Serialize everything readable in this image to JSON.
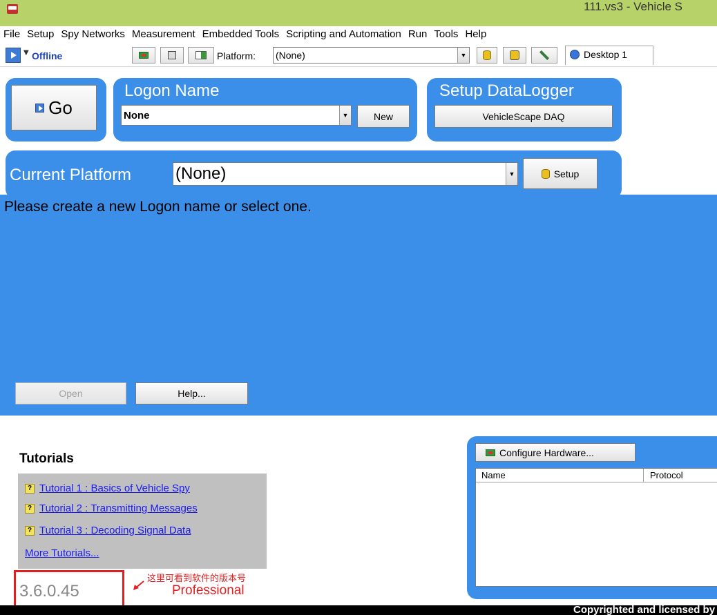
{
  "window": {
    "title": "111.vs3 - Vehicle S"
  },
  "menu": [
    {
      "label": "File"
    },
    {
      "label": "Setup"
    },
    {
      "label": "Spy Networks"
    },
    {
      "label": "Measurement"
    },
    {
      "label": "Embedded Tools"
    },
    {
      "label": "Scripting and Automation"
    },
    {
      "label": "Run"
    },
    {
      "label": "Tools"
    },
    {
      "label": "Help"
    }
  ],
  "toolbar": {
    "status": "Offline",
    "platform_label": "Platform:",
    "platform_value": "(None)",
    "desktop_tab": "Desktop 1"
  },
  "go_panel": {
    "go_label": "Go"
  },
  "logon": {
    "title": "Logon Name",
    "selected": "None",
    "new_label": "New"
  },
  "datalogger": {
    "title": "Setup DataLogger",
    "button_label": "VehicleScape DAQ"
  },
  "platform_panel": {
    "title": "Current Platform",
    "selected": "(None)",
    "setup_label": "Setup"
  },
  "content": {
    "message": "Please create a new Logon name or select one.",
    "open_label": "Open",
    "help_label": "Help..."
  },
  "tutorials": {
    "heading": "Tutorials",
    "items": [
      {
        "label": "Tutorial 1 : Basics of Vehicle Spy"
      },
      {
        "label": "Tutorial 2 : Transmitting Messages"
      },
      {
        "label": "Tutorial 3 : Decoding Signal Data"
      }
    ],
    "more_label": "More Tutorials..."
  },
  "version": {
    "number": "3.6.0.45",
    "annotation": "这里可看到软件的版本号",
    "edition": "Professional"
  },
  "hardware": {
    "configure_label": "Configure Hardware...",
    "columns": [
      "Name",
      "Protocol"
    ]
  },
  "footer": {
    "copyright": "Copyrighted and licensed by Intrepid Co"
  },
  "colors": {
    "titlebar": "#b8d26a",
    "panel_blue": "#3b8fe8",
    "annotation_red": "#e02020",
    "link_blue": "#1a1aee"
  }
}
